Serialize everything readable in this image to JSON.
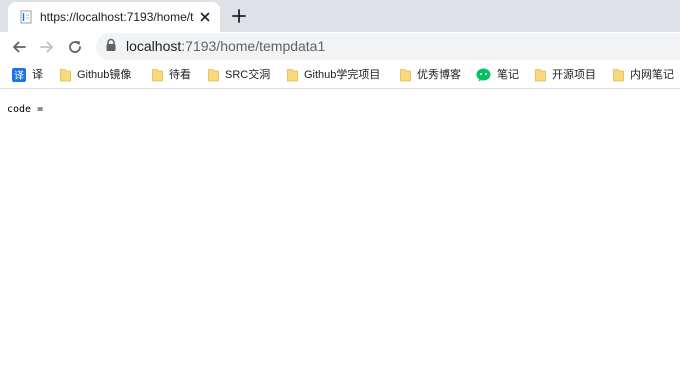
{
  "tab": {
    "title": "https://localhost:7193/home/t"
  },
  "address_bar": {
    "host": "localhost",
    "path": ":7193/home/tempdata1"
  },
  "bookmarks": [
    {
      "label": "译",
      "icon": "translate-icon"
    },
    {
      "label": "Github镜像",
      "icon": "folder-icon"
    },
    {
      "label": "待看",
      "icon": "folder-icon"
    },
    {
      "label": "SRC交洞",
      "icon": "folder-icon"
    },
    {
      "label": "Github学完项目",
      "icon": "folder-icon"
    },
    {
      "label": "优秀博客",
      "icon": "folder-icon"
    },
    {
      "label": "笔记",
      "icon": "wechat-icon"
    },
    {
      "label": "开源项目",
      "icon": "folder-icon"
    },
    {
      "label": "内网笔记",
      "icon": "folder-icon"
    }
  ],
  "page": {
    "text": "code ="
  },
  "colors": {
    "tabstrip": "#dee1e6",
    "omnibox": "#f1f3f4",
    "folder": "#f9d97a",
    "translate": "#1a73e8",
    "wechat": "#07c160"
  }
}
